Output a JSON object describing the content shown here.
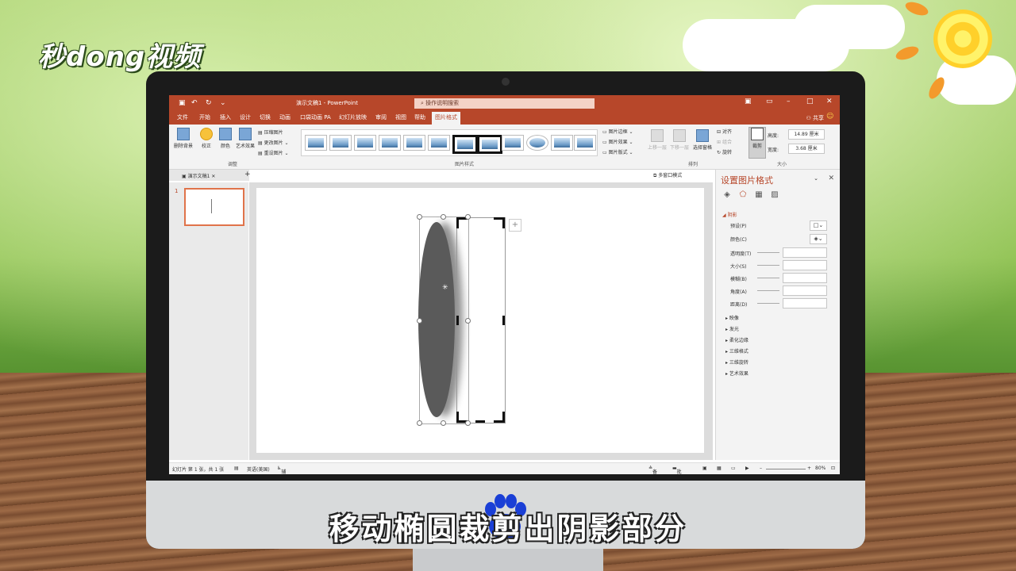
{
  "watermark": {
    "logo_text": "秒dong视频"
  },
  "window": {
    "doc_title": "演示文稿1 - PowerPoint",
    "search_placeholder": "操作说明搜索",
    "share_label": "共享"
  },
  "ribbon_tabs": [
    "文件",
    "开始",
    "插入",
    "设计",
    "切换",
    "动画",
    "幻灯片放映",
    "口袋动画 PA",
    "审阅",
    "视图",
    "帮助",
    "图片格式"
  ],
  "ribbon": {
    "remove_bg": "删除背景",
    "corrections": "校正",
    "color": "颜色",
    "artistic": "艺术效果",
    "compress": "压缩图片",
    "change_pic": "更改图片",
    "reset_pic": "重设图片",
    "group_adjust": "调整",
    "group_styles": "图片样式",
    "border": "图片边框",
    "effects": "图片效果",
    "layout": "图片版式",
    "bring_forward": "上移一层",
    "send_backward": "下移一层",
    "selection_pane": "选择窗格",
    "align": "对齐",
    "group": "组合",
    "rotate": "旋转",
    "group_arrange": "排列",
    "crop": "裁剪",
    "height_label": "高度:",
    "height_value": "14.89 厘米",
    "width_label": "宽度:",
    "width_value": "3.68 厘米",
    "group_size": "大小"
  },
  "doc_tab": {
    "name": "演示文稿1",
    "multiwindow": "多窗口模式"
  },
  "slides": {
    "first_number": "1"
  },
  "format_pane": {
    "title": "设置图片格式",
    "section_shadow": "阴影",
    "preset_label": "预设(P)",
    "color_label": "颜色(C)",
    "transparency_label": "透明度(T)",
    "size_label": "大小(S)",
    "blur_label": "模糊(B)",
    "angle_label": "角度(A)",
    "distance_label": "距离(D)",
    "collapsed": [
      "映像",
      "发光",
      "柔化边缘",
      "三维格式",
      "三维旋转",
      "艺术效果"
    ]
  },
  "status": {
    "slide_info": "幻灯片 第 1 张，共 1 张",
    "language": "英语(美国)",
    "accessibility": "辅助功能: 调查",
    "notes": "备注",
    "comments": "批注",
    "zoom": "80%"
  },
  "caption": "移动椭圆裁剪出阴影部分"
}
